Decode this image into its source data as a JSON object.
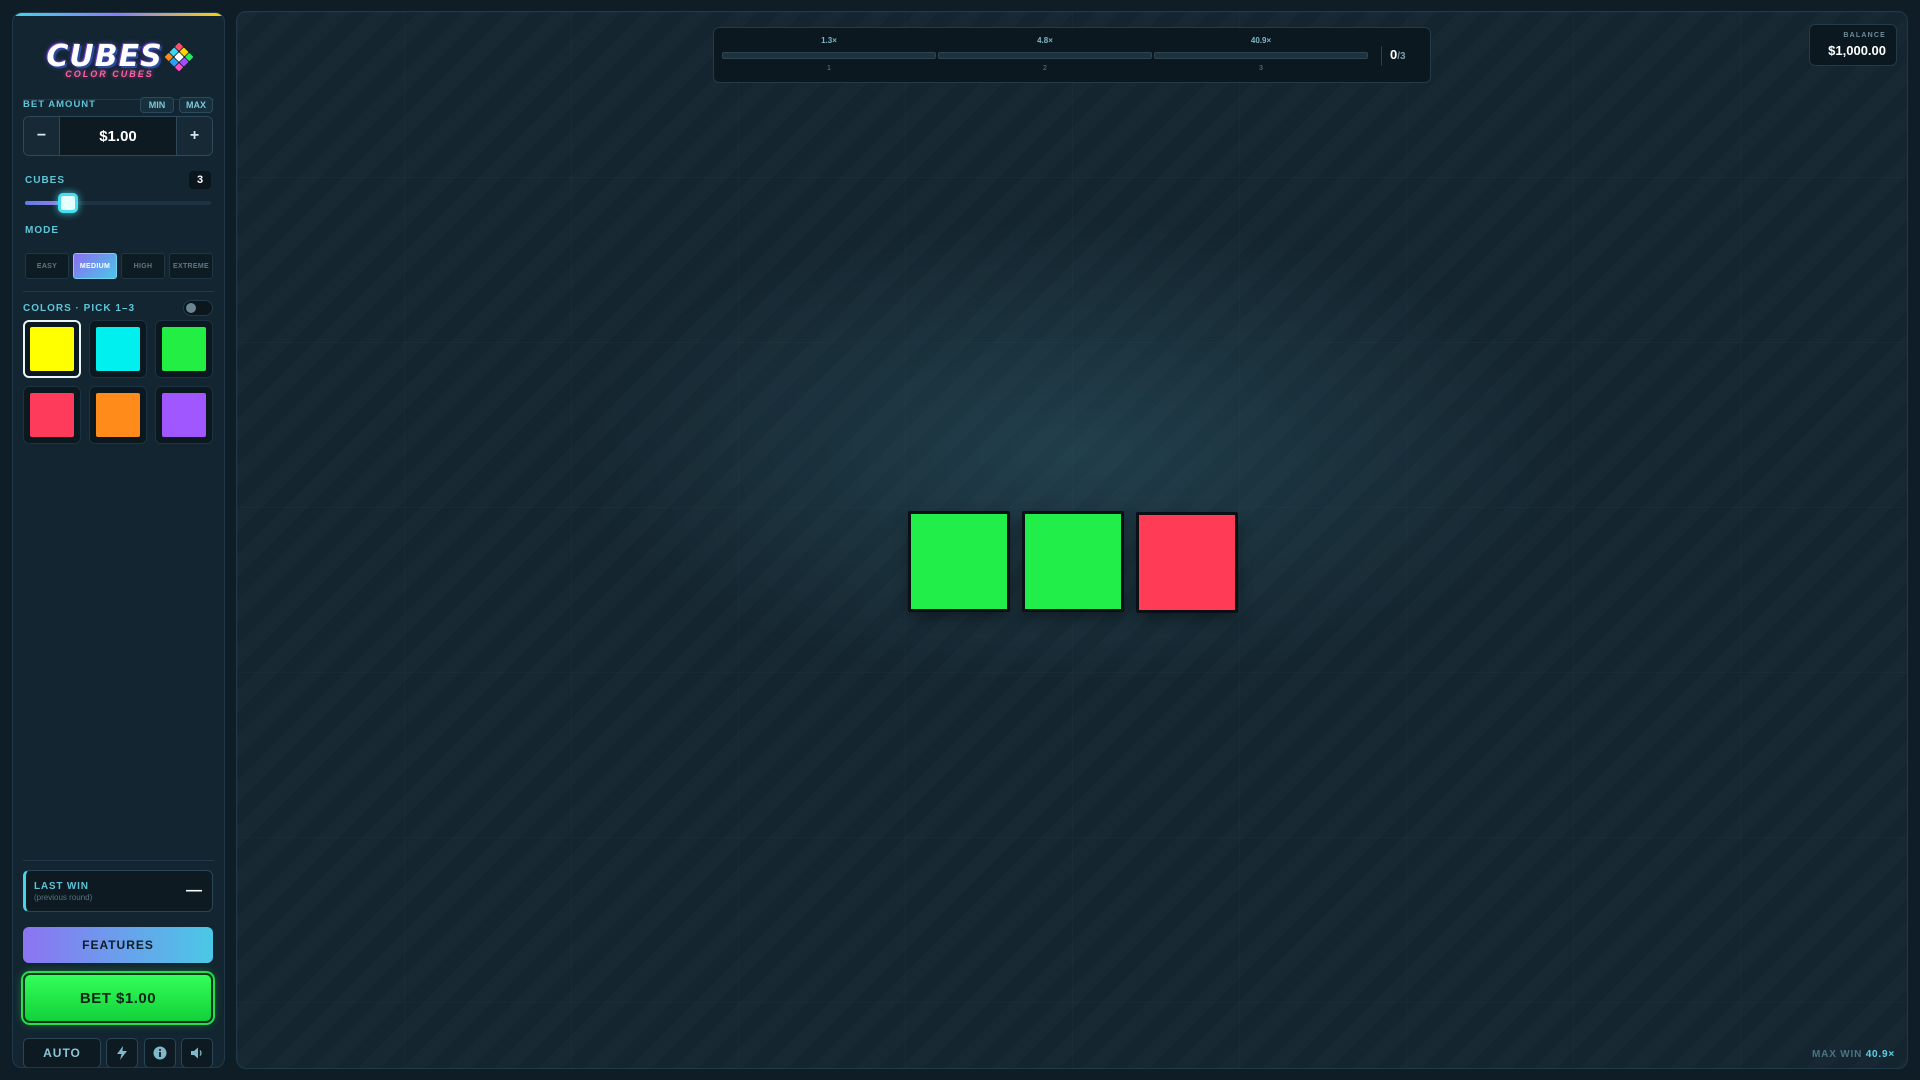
{
  "game": {
    "logo_title": "CUBES",
    "logo_subtitle": "COLOR CUBES",
    "logo_cube_colors": [
      "#ff4d6d",
      "#ffd400",
      "#22ee55",
      "#3fd6f0",
      "#ffffff",
      "#a34dff",
      "#ff8a1c",
      "#27a0ff",
      "#ff4dc4"
    ]
  },
  "sidebar": {
    "bet": {
      "label": "BET AMOUNT",
      "min_label": "MIN",
      "max_label": "MAX",
      "minus_symbol": "−",
      "plus_symbol": "+",
      "value": "$1.00"
    },
    "cubes": {
      "label": "CUBES",
      "count": "3",
      "slider_level": 0.23
    },
    "mode": {
      "label": "MODE",
      "options": [
        "EASY",
        "MEDIUM",
        "HIGH",
        "EXTREME"
      ],
      "selected": "MEDIUM"
    },
    "colors": {
      "label": "COLORS · PICK 1–3",
      "toggle_on": false,
      "swatches": [
        {
          "name": "yellow",
          "color": "#ffff00",
          "selected": true
        },
        {
          "name": "cyan",
          "color": "#00f0f0",
          "selected": false
        },
        {
          "name": "green",
          "color": "#22ee44",
          "selected": false
        },
        {
          "name": "red",
          "color": "#ff3b5c",
          "selected": false
        },
        {
          "name": "orange",
          "color": "#ff8c1a",
          "selected": false
        },
        {
          "name": "purple",
          "color": "#a157ff",
          "selected": false
        }
      ]
    },
    "last_win": {
      "title": "LAST WIN",
      "subtitle": "(previous round)",
      "value": "—"
    },
    "features_label": "FEATURES",
    "bet_button_label": "BET $1.00",
    "auto_label": "AUTO",
    "icons": {
      "turbo": "lightning-icon",
      "info": "info-icon",
      "sound": "speaker-icon"
    }
  },
  "stage": {
    "progress": {
      "segments": [
        {
          "multiplier": "1.3×",
          "index": "1"
        },
        {
          "multiplier": "4.8×",
          "index": "2"
        },
        {
          "multiplier": "40.9×",
          "index": "3"
        }
      ],
      "count": "0",
      "total": "/3"
    },
    "balance": {
      "label": "BALANCE",
      "value": "$1,000.00"
    },
    "cubes": [
      {
        "color": "#22ee4a"
      },
      {
        "color": "#22ee4a"
      },
      {
        "color": "#ff3b56"
      }
    ],
    "max_win": {
      "label": "MAX WIN",
      "value": "40.9×"
    }
  },
  "theme": {
    "accent": "#47d4e6",
    "bet_green": "#22ee4a"
  }
}
